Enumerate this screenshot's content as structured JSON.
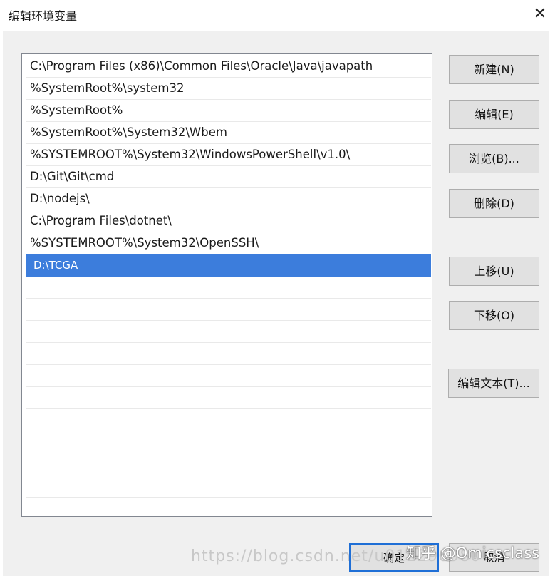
{
  "window": {
    "title": "编辑环境变量",
    "close_glyph": "✕"
  },
  "path_list": {
    "items": [
      "C:\\Program Files (x86)\\Common Files\\Oracle\\Java\\javapath",
      "%SystemRoot%\\system32",
      "%SystemRoot%",
      "%SystemRoot%\\System32\\Wbem",
      "%SYSTEMROOT%\\System32\\WindowsPowerShell\\v1.0\\",
      "D:\\Git\\Git\\cmd",
      "D:\\nodejs\\",
      "C:\\Program Files\\dotnet\\",
      "%SYSTEMROOT%\\System32\\OpenSSH\\",
      "D:\\TCGA"
    ],
    "selected_index": 9
  },
  "buttons": {
    "new": "新建(N)",
    "edit": "编辑(E)",
    "browse": "浏览(B)...",
    "delete": "删除(D)",
    "move_up": "上移(U)",
    "move_down": "下移(O)",
    "edit_text": "编辑文本(T)...",
    "ok": "确定",
    "cancel": "取消"
  },
  "watermark": {
    "url": "https://blog.csdn.net/u012296980",
    "zhihu": "知乎 @Omicsclass"
  },
  "colors": {
    "selection": "#3c7ddc",
    "dialog_bg": "#f0f0f0",
    "button_bg": "#e1e1e1",
    "default_button_border": "#1f6fd6"
  }
}
